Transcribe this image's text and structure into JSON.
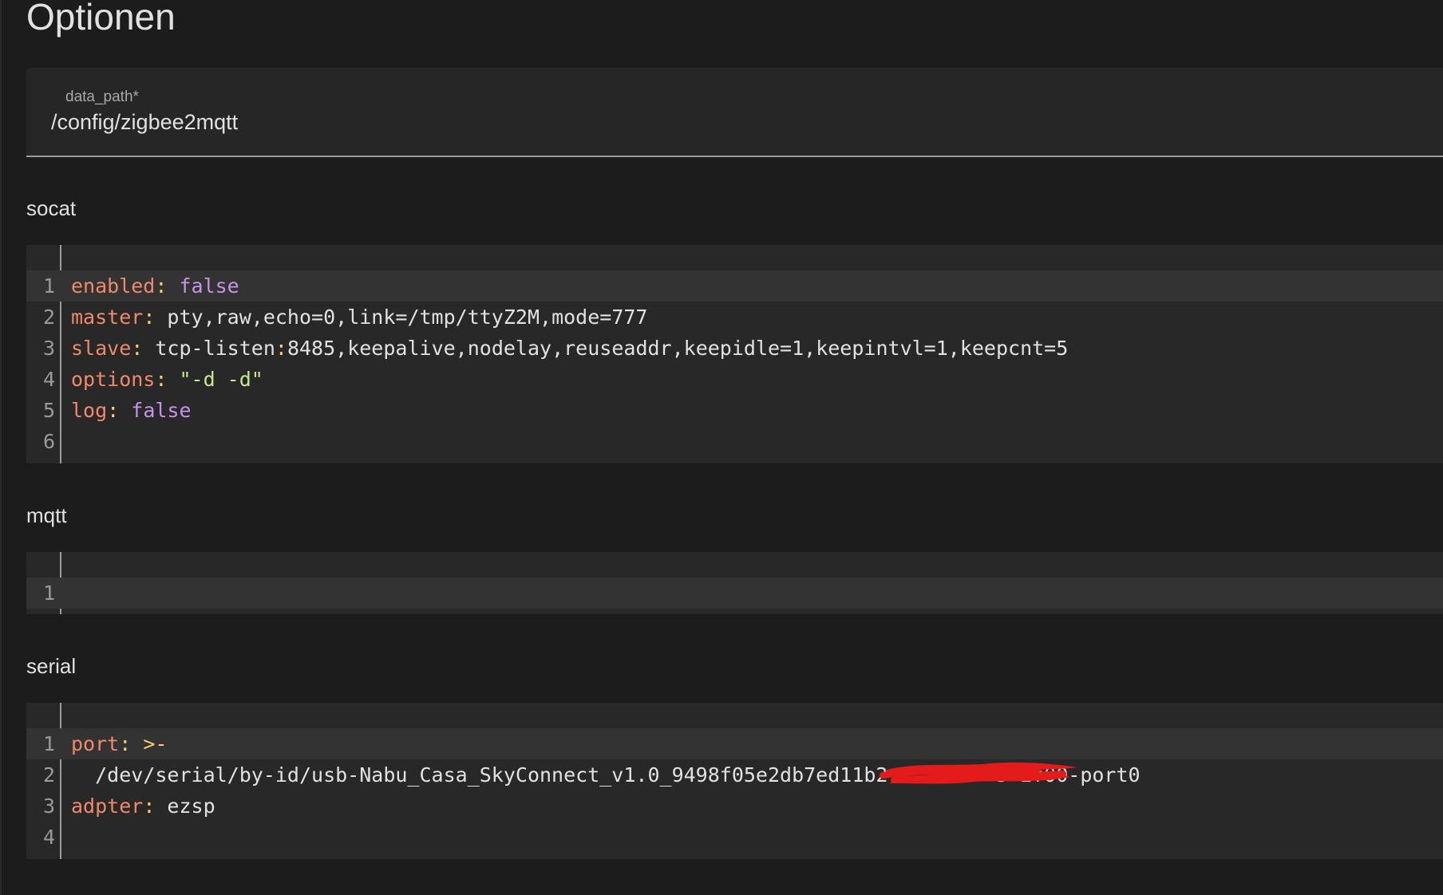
{
  "title": "Optionen",
  "data_path": {
    "label": "data_path*",
    "value": "/config/zigbee2mqtt"
  },
  "sections": {
    "socat": {
      "label": "socat",
      "lines": [
        {
          "n": "1",
          "key": "enabled",
          "value": "false"
        },
        {
          "n": "2",
          "key": "master",
          "value": "pty,raw,echo=0,link=/tmp/ttyZ2M,mode=777"
        },
        {
          "n": "3",
          "key": "slave",
          "value_a": "tcp-listen",
          "value_b": "8485,keepalive,nodelay,reuseaddr,keepidle=1,keepintvl=1,keepcnt=5"
        },
        {
          "n": "4",
          "key": "options",
          "value": "\"-d -d\""
        },
        {
          "n": "5",
          "key": "log",
          "value": "false"
        },
        {
          "n": "6"
        }
      ]
    },
    "mqtt": {
      "label": "mqtt",
      "lines": [
        {
          "n": "1"
        }
      ]
    },
    "serial": {
      "label": "serial",
      "lines": [
        {
          "n": "1",
          "key": "port",
          "value": ">-"
        },
        {
          "n": "2",
          "value_prefix": "  /dev/serial/by-id/usb-Nabu_Casa_SkyConnect_v1.0_9498f05e2db7ed11b2",
          "value_suffix": "5-if00-port0"
        },
        {
          "n": "3",
          "key": "adpter",
          "value": "ezsp"
        },
        {
          "n": "4"
        }
      ]
    }
  },
  "colors": {
    "key": "#f0896a",
    "boolean": "#c792ea",
    "string": "#c3e88d",
    "redaction": "#e31b1b"
  }
}
